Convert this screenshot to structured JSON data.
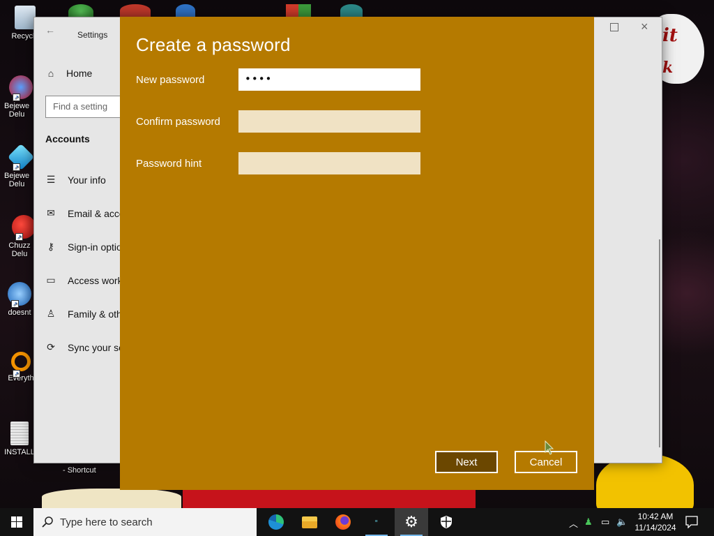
{
  "desktop": {
    "icons": [
      {
        "label": "Recycle",
        "icon": "recycle-bin-icon"
      },
      {
        "label": "Bejewe Delu",
        "icon": "bejeweled-icon"
      },
      {
        "label": "Bejewe Delu",
        "icon": "bejeweled-gem-icon"
      },
      {
        "label": "Chuzz Delu",
        "icon": "chuzzle-icon"
      },
      {
        "label": "doesnt",
        "icon": "app-icon"
      },
      {
        "label": "Everyth",
        "icon": "search-magnifier-icon"
      },
      {
        "label": "INSTALL",
        "icon": "document-icon"
      }
    ],
    "wallpaper_texts": {
      "shortcut": "- Shortcut",
      "top_right_1": "it",
      "top_right_2": "k"
    }
  },
  "settings": {
    "title": "Settings",
    "home_label": "Home",
    "search_placeholder": "Find a setting",
    "section": "Accounts",
    "nav": [
      {
        "label": "Your info",
        "icon": "person-card-icon"
      },
      {
        "label": "Email & acco",
        "icon": "mail-icon"
      },
      {
        "label": "Sign-in optio",
        "icon": "key-icon"
      },
      {
        "label": "Access work",
        "icon": "briefcase-icon"
      },
      {
        "label": "Family & oth",
        "icon": "add-person-icon"
      },
      {
        "label": "Sync your se",
        "icon": "sync-icon"
      }
    ]
  },
  "dialog": {
    "title": "Create a password",
    "fields": [
      {
        "label": "New password",
        "value": "••••"
      },
      {
        "label": "Confirm password",
        "value": ""
      },
      {
        "label": "Password hint",
        "value": ""
      }
    ],
    "next_label": "Next",
    "cancel_label": "Cancel",
    "bg_color": "#b57a00"
  },
  "taskbar": {
    "search_placeholder": "Type here to search",
    "apps": [
      "edge-icon",
      "file-explorer-icon",
      "firefox-icon",
      "chaos-app-icon",
      "settings-gear-icon",
      "security-shield-icon"
    ],
    "clock_time": "10:42 AM",
    "clock_date": "11/14/2024"
  }
}
